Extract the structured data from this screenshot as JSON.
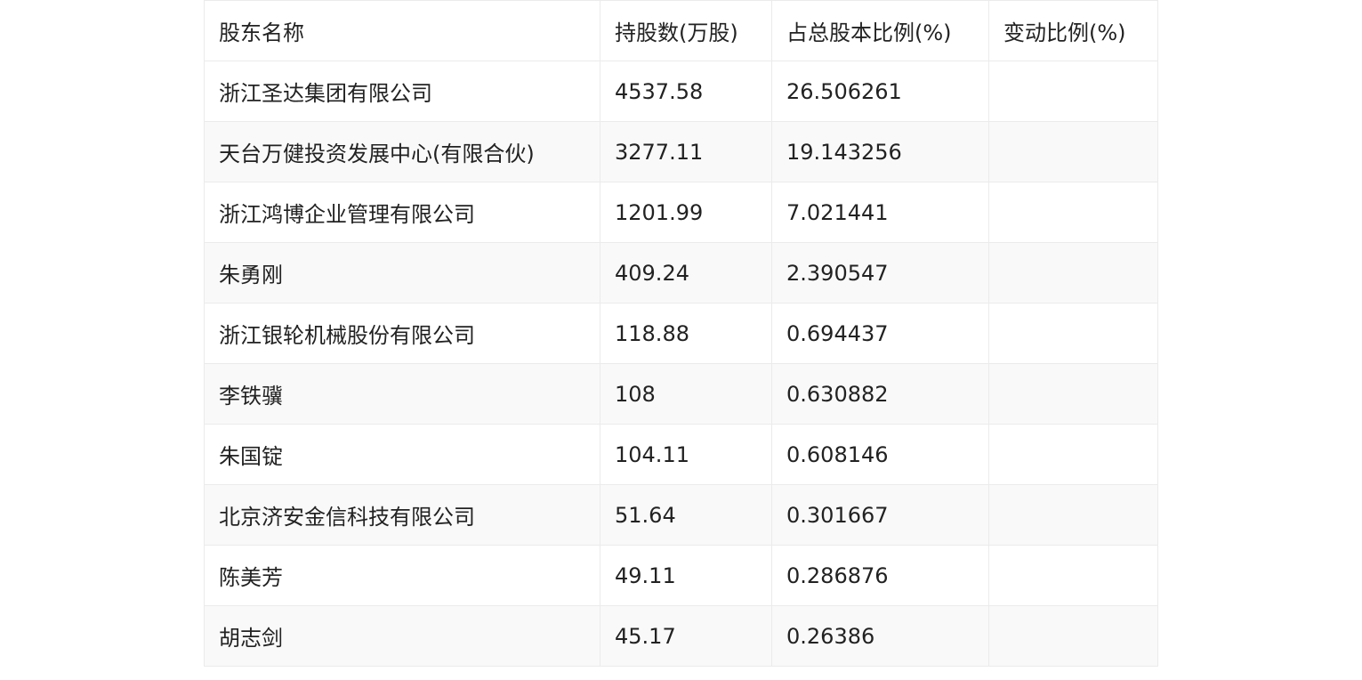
{
  "table": {
    "headers": [
      "股东名称",
      "持股数(万股)",
      "占总股本比例(%)",
      "变动比例(%)"
    ],
    "rows": [
      [
        "浙江圣达集团有限公司",
        "4537.58",
        "26.506261",
        ""
      ],
      [
        "天台万健投资发展中心(有限合伙)",
        "3277.11",
        "19.143256",
        ""
      ],
      [
        "浙江鸿博企业管理有限公司",
        "1201.99",
        "7.021441",
        ""
      ],
      [
        "朱勇刚",
        "409.24",
        "2.390547",
        ""
      ],
      [
        "浙江银轮机械股份有限公司",
        "118.88",
        "0.694437",
        ""
      ],
      [
        "李铁骥",
        "108",
        "0.630882",
        ""
      ],
      [
        "朱国锭",
        "104.11",
        "0.608146",
        ""
      ],
      [
        "北京济安金信科技有限公司",
        "51.64",
        "0.301667",
        ""
      ],
      [
        "陈美芳",
        "49.11",
        "0.286876",
        ""
      ],
      [
        "胡志剑",
        "45.17",
        "0.26386",
        ""
      ]
    ]
  }
}
